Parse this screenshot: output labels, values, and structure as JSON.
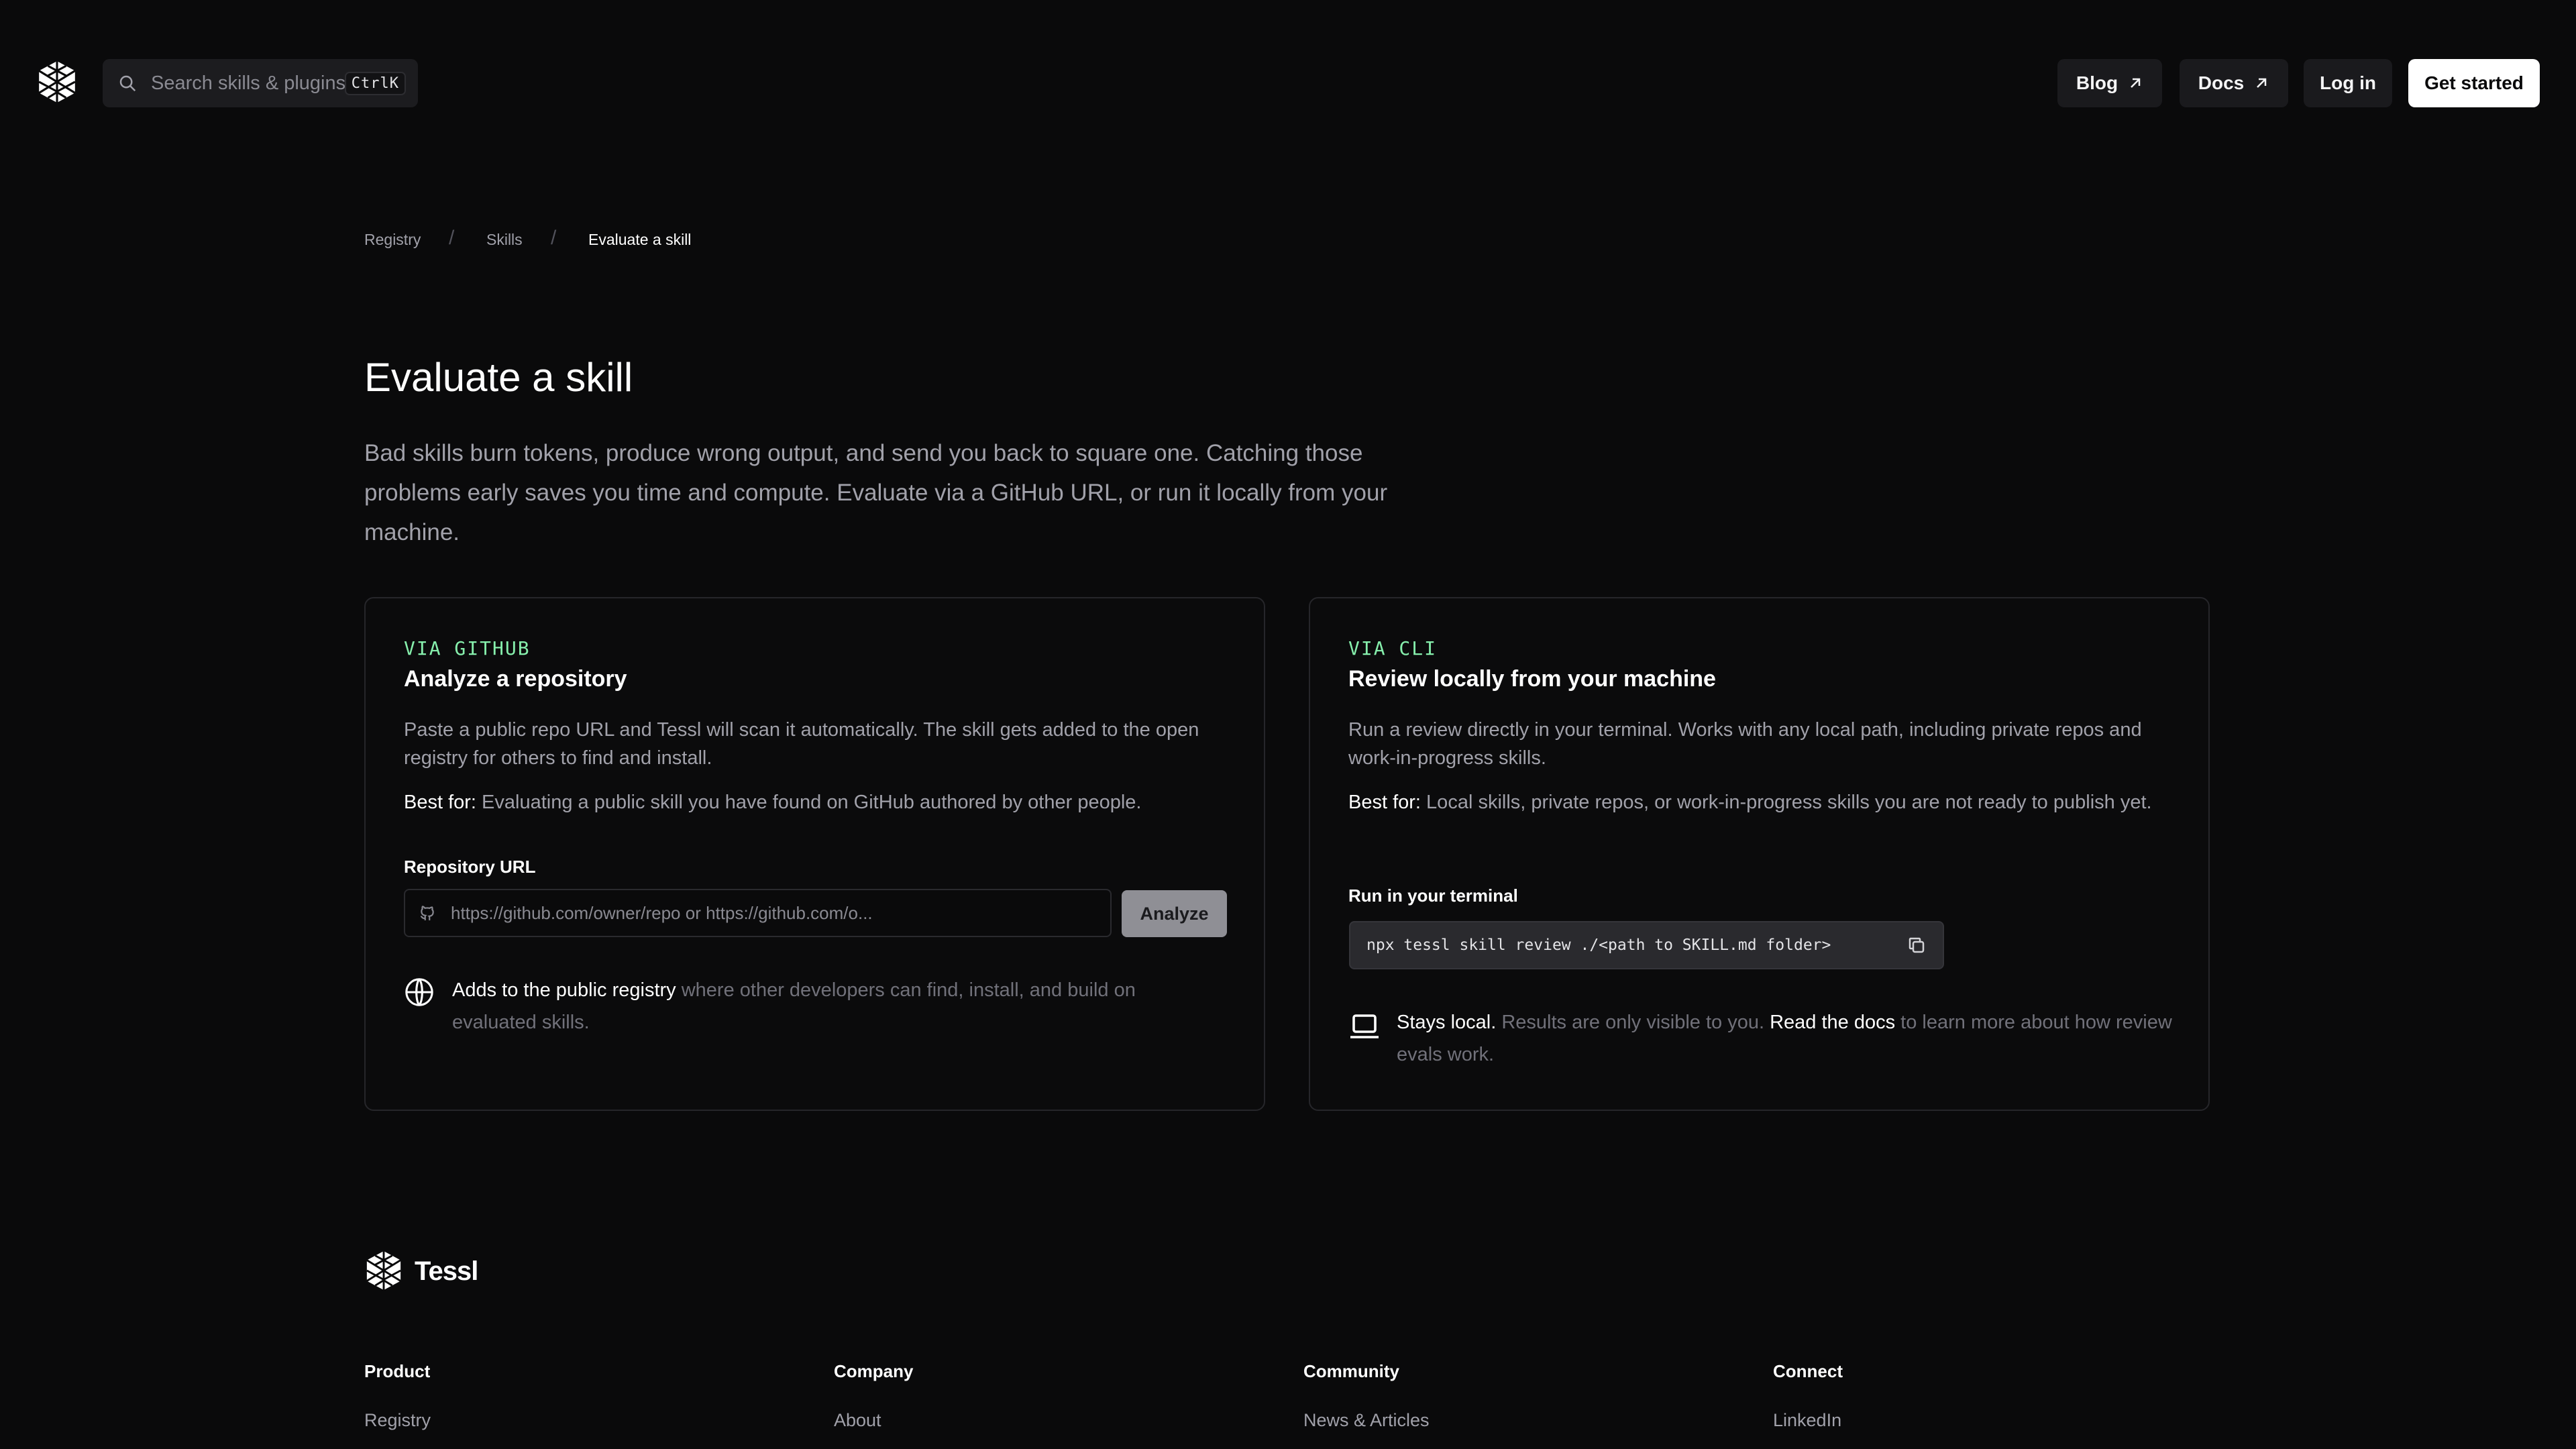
{
  "header": {
    "search": {
      "placeholder": "Search skills & plugins...",
      "shortcut": "CtrlK"
    },
    "nav": {
      "blog": "Blog",
      "docs": "Docs",
      "login": "Log in",
      "get_started": "Get started"
    }
  },
  "breadcrumb": {
    "items": [
      "Registry",
      "Skills",
      "Evaluate a skill"
    ],
    "separator": "/"
  },
  "page": {
    "title": "Evaluate a skill",
    "lead": "Bad skills burn tokens, produce wrong output, and send you back to square one. Catching those problems early saves you time and compute. Evaluate via a GitHub URL, or run it locally from your machine."
  },
  "github_card": {
    "eyebrow": "VIA GITHUB",
    "title": "Analyze a repository",
    "description": "Paste a public repo URL and Tessl will scan it automatically. The skill gets added to the open registry for others to find and install.",
    "best_label": "Best for:",
    "best_text": " Evaluating a public skill you have found on GitHub authored by other people.",
    "field_label": "Repository URL",
    "input_placeholder": "https://github.com/owner/repo or https://github.com/o...",
    "button": "Analyze",
    "note_highlight": "Adds to the public registry",
    "note_text": " where other developers can find, install, and build on evaluated skills."
  },
  "cli_card": {
    "eyebrow": "VIA CLI",
    "title": "Review locally from your machine",
    "description": "Run a review directly in your terminal. Works with any local path, including private repos and work-in-progress skills.",
    "best_label": "Best for:",
    "best_text": " Local skills, private repos, or work-in-progress skills you are not ready to publish yet.",
    "field_label": "Run in your terminal",
    "command": "npx tessl skill review ./<path to SKILL.md folder>",
    "note_highlight": "Stays local.",
    "note_text": " Results are only visible to you. ",
    "note_link": "Read the docs",
    "note_text2": " to learn more about how review evals work."
  },
  "footer": {
    "brand": "Tessl",
    "columns": [
      {
        "heading": "Product",
        "first_link": "Registry"
      },
      {
        "heading": "Company",
        "first_link": "About"
      },
      {
        "heading": "Community",
        "first_link": "News & Articles"
      },
      {
        "heading": "Connect",
        "first_link": "LinkedIn"
      }
    ]
  },
  "colors": {
    "background": "#0a0a0b",
    "accent_green": "#86efac",
    "primary_button": "#ffffff"
  },
  "icons": [
    "tessl-logo-icon",
    "search-icon",
    "arrow-up-right-icon",
    "github-icon",
    "globe-icon",
    "laptop-icon",
    "copy-icon"
  ]
}
